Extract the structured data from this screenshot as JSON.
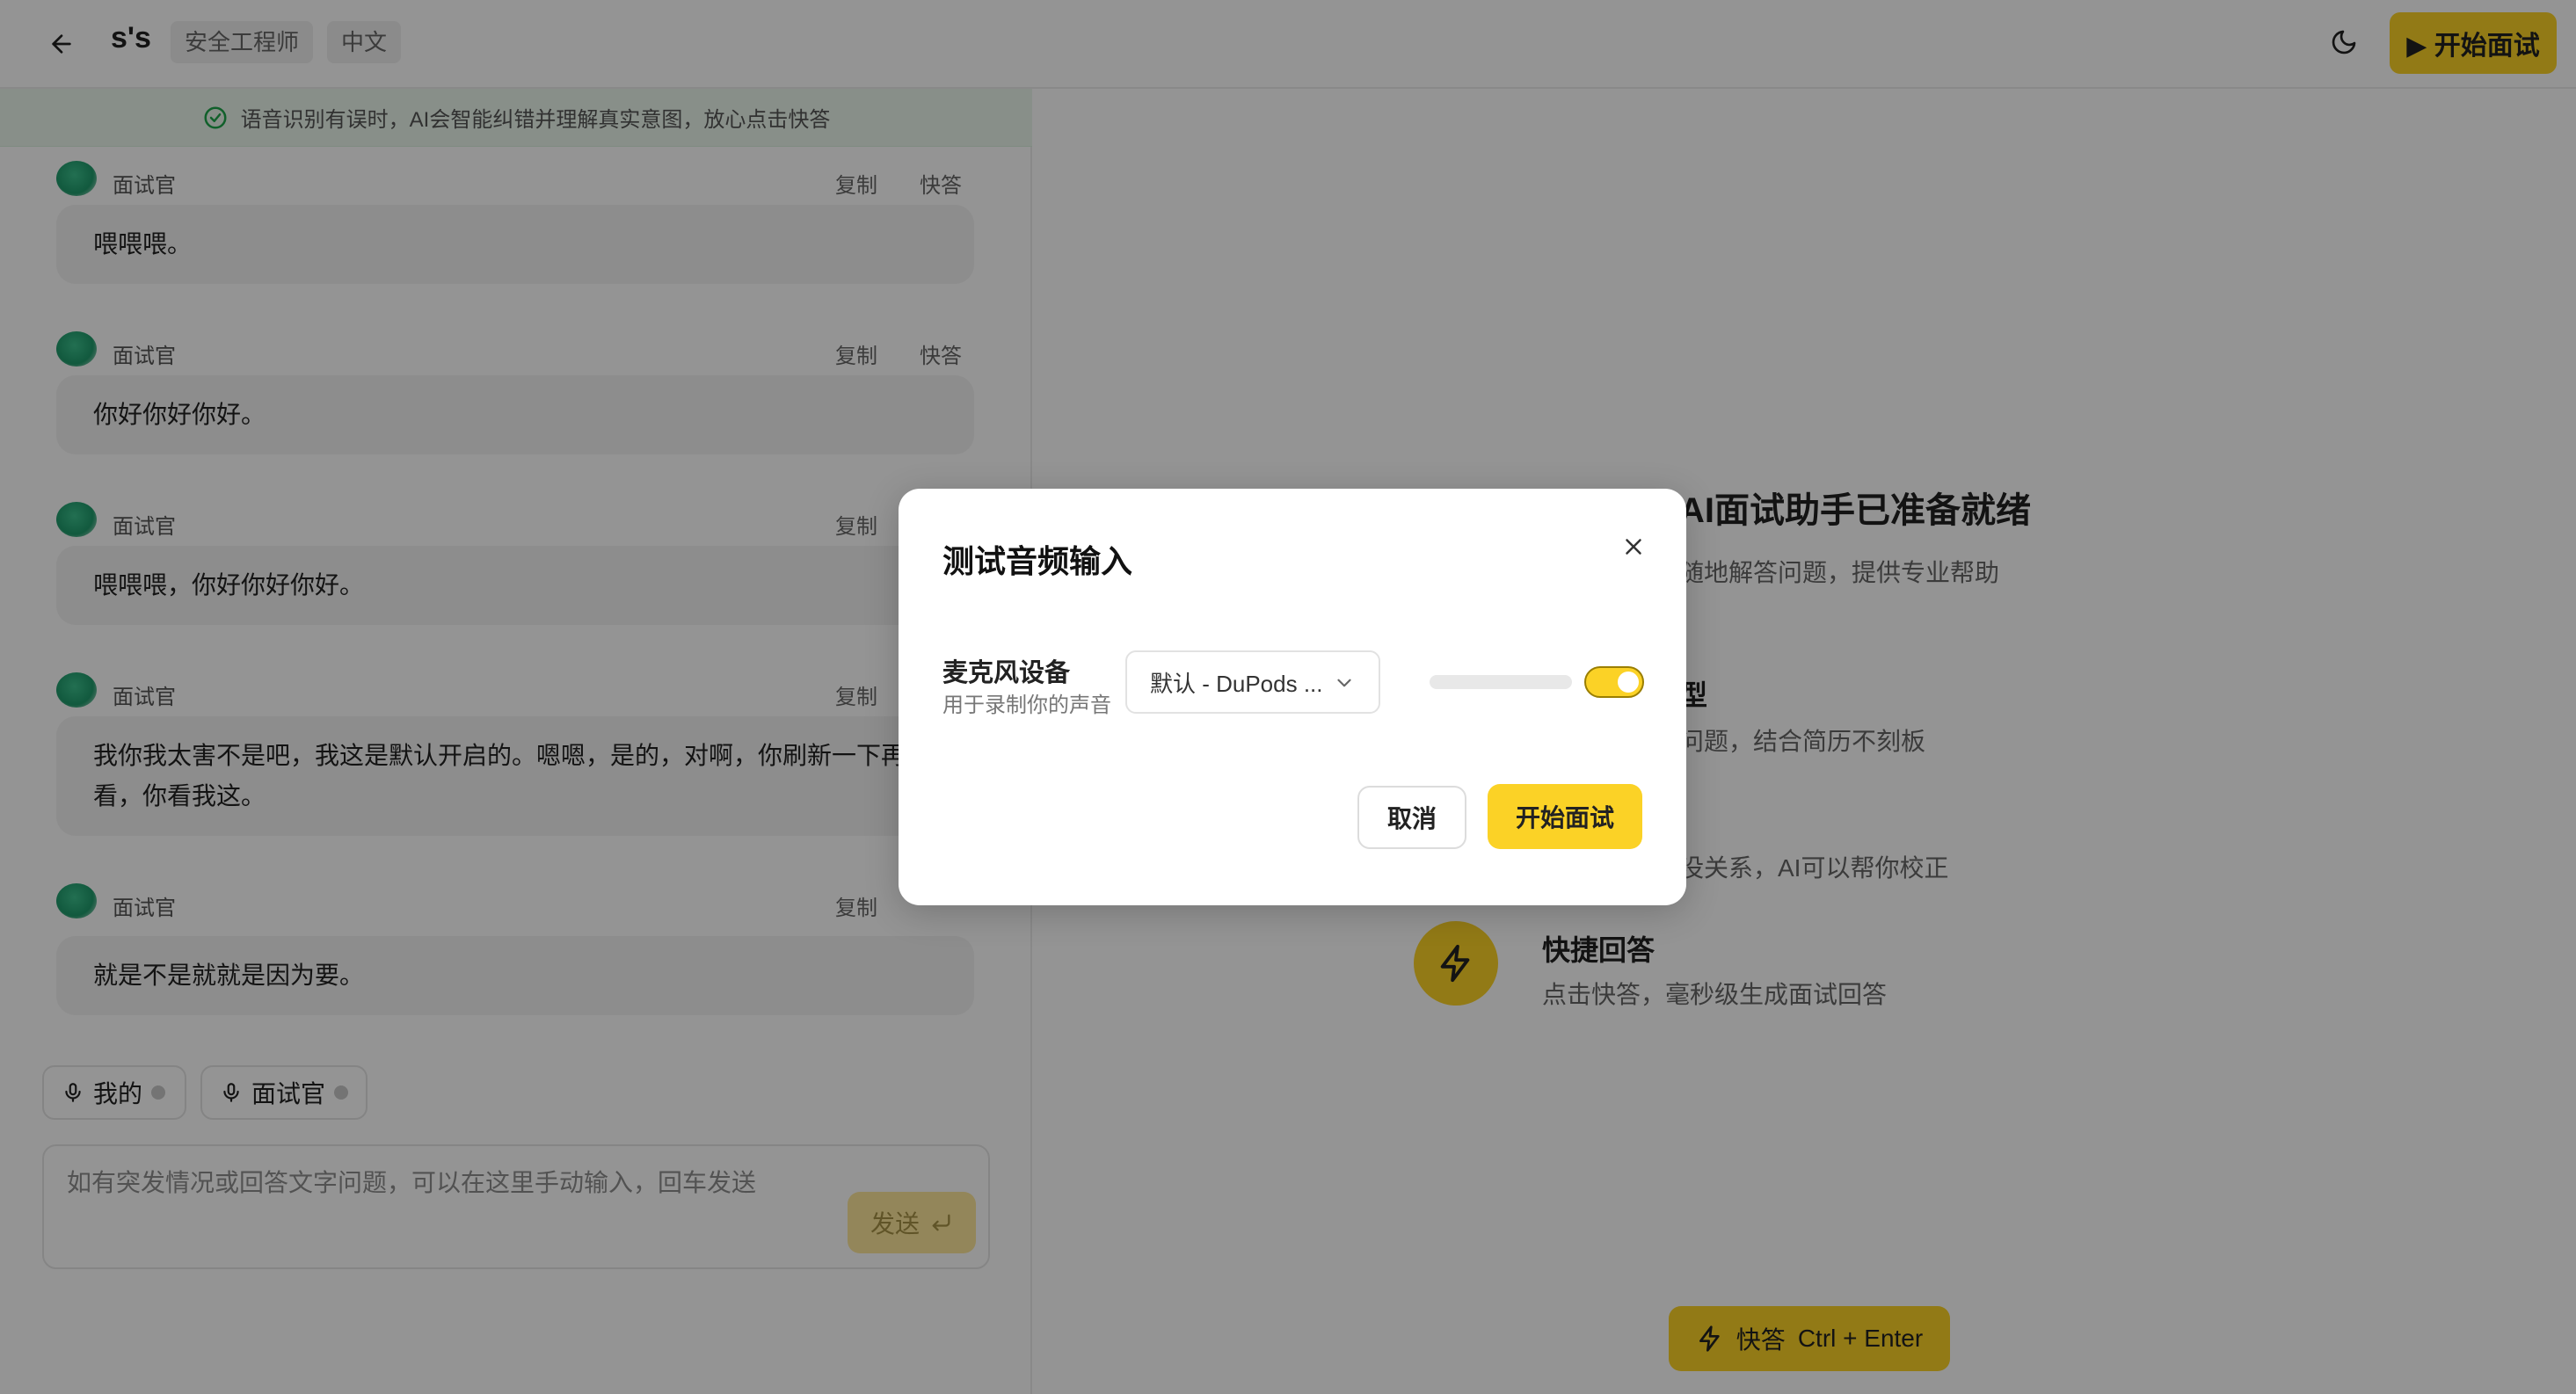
{
  "header": {
    "title": "s's",
    "role_tag": "安全工程师",
    "lang_tag": "中文",
    "start_label": "▶ 开始面试"
  },
  "notice": {
    "text": "语音识别有误时，AI会智能纠错并理解真实意图，放心点击快答"
  },
  "messages": [
    {
      "speaker": "面试官",
      "copy": "复制",
      "quick": "快答",
      "text": "喂喂喂。"
    },
    {
      "speaker": "面试官",
      "copy": "复制",
      "quick": "快答",
      "text": "你好你好你好。"
    },
    {
      "speaker": "面试官",
      "copy": "复制",
      "quick": "",
      "text": "喂喂喂，你好你好你好。"
    },
    {
      "speaker": "面试官",
      "copy": "复制",
      "quick": "",
      "text": "我你我太害不是吧，我这是默认开启的。嗯嗯，是的，对啊，你刷新一下再",
      "text2": "看，你看我这。"
    },
    {
      "speaker": "面试官",
      "copy": "复制",
      "quick": "",
      "text": "就是不是就就是因为要。"
    }
  ],
  "chips": {
    "mine": "我的",
    "interviewer": "面试官"
  },
  "input": {
    "placeholder": "如有突发情况或回答文字问题，可以在这里手动输入，回车发送",
    "send": "发送"
  },
  "right": {
    "title": "AI面试助手已准备就绪",
    "subtitle": "随地解答问题，提供专业帮助",
    "feature1_title": "型",
    "feature1_desc": "问题，结合简历不刻板",
    "feature2_desc": "没关系，AI可以帮你校正",
    "feature3_title": "快捷回答",
    "feature3_desc": "点击快答，毫秒级生成面试回答",
    "quick_button": "快答",
    "quick_shortcut": "Ctrl + Enter"
  },
  "modal": {
    "title": "测试音频输入",
    "mic_label": "麦克风设备",
    "mic_hint": "用于录制你的声音",
    "mic_selected": "默认 - DuPods ...",
    "level": 0.0,
    "toggle_on": true,
    "cancel": "取消",
    "start": "开始面试"
  },
  "colors": {
    "accent": "#fbd226",
    "notice_bg": "#eaf7ec",
    "check": "#1ea64a"
  },
  "icons": [
    "back-arrow-icon",
    "moon-icon",
    "check-circle-icon",
    "mic-icon",
    "enter-icon",
    "lightning-icon",
    "close-icon",
    "chevron-down-icon"
  ]
}
